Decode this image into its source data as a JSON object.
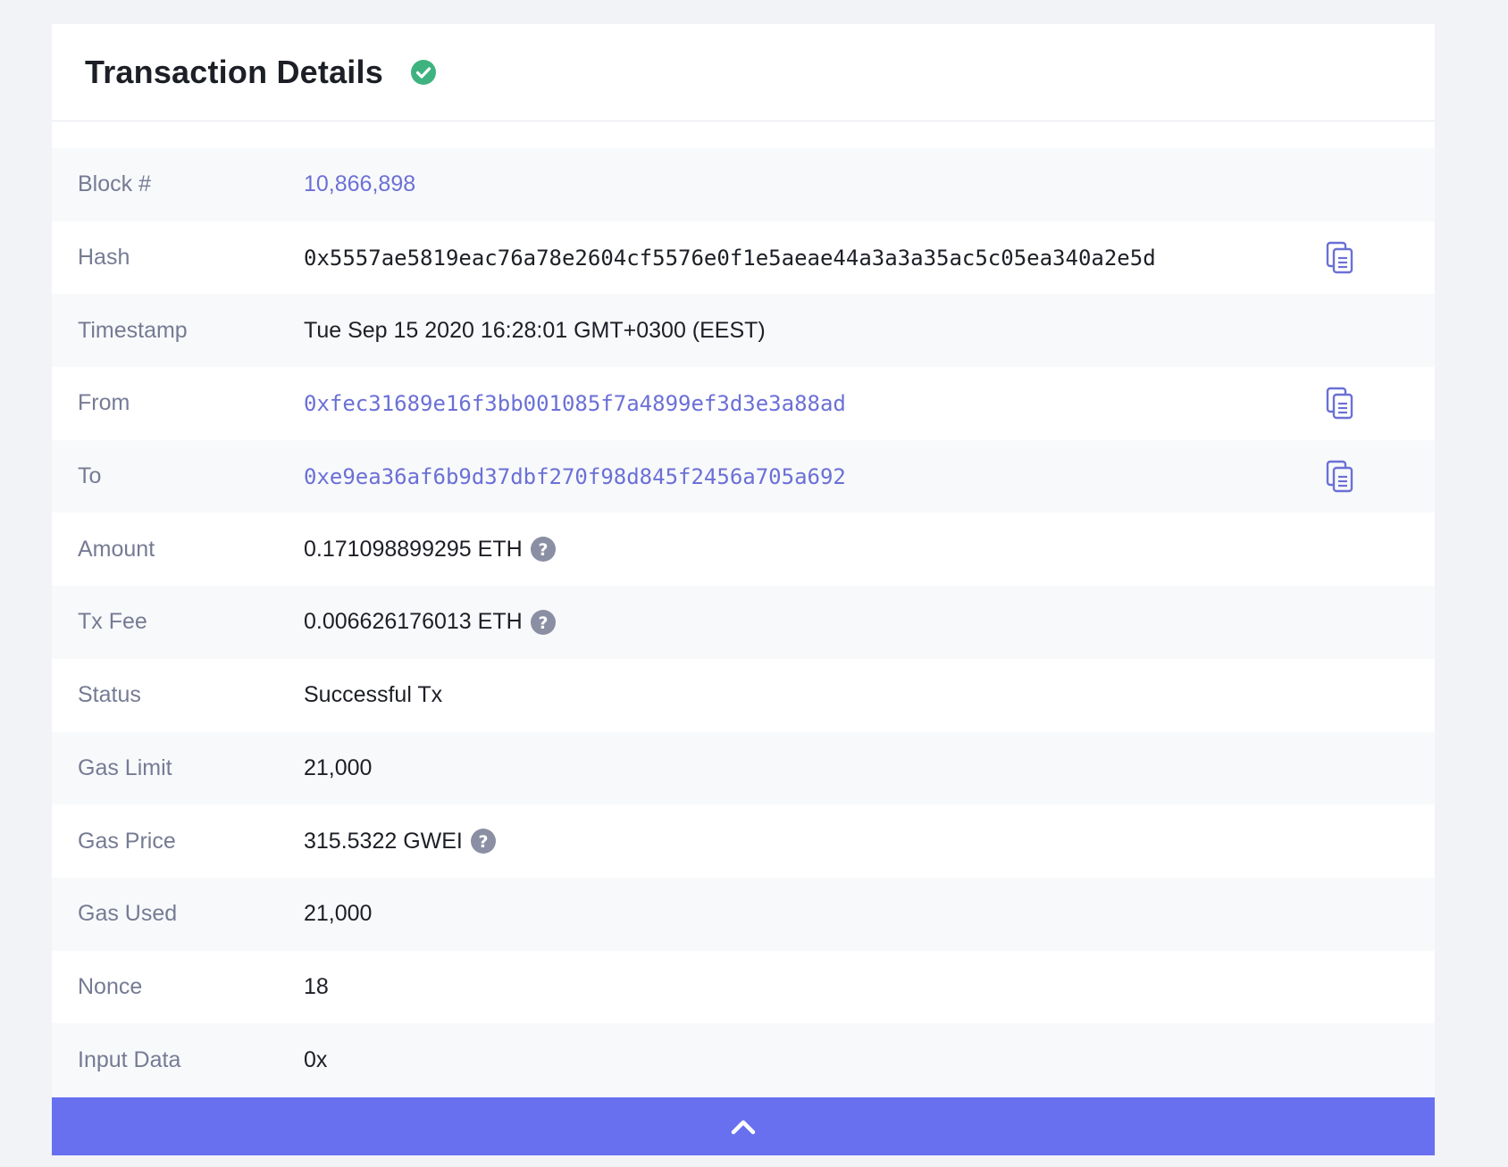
{
  "header": {
    "title": "Transaction Details",
    "status_icon": "check-circle-icon",
    "status_color": "#3fb37f"
  },
  "rows": [
    {
      "label": "Block #",
      "value": "10,866,898"
    },
    {
      "label": "Hash",
      "value": "0x5557ae5819eac76a78e2604cf5576e0f1e5aeae44a3a3a35ac5c05ea340a2e5d"
    },
    {
      "label": "Timestamp",
      "value": "Tue Sep 15 2020 16:28:01 GMT+0300 (EEST)"
    },
    {
      "label": "From",
      "value": "0xfec31689e16f3bb001085f7a4899ef3d3e3a88ad"
    },
    {
      "label": "To",
      "value": "0xe9ea36af6b9d37dbf270f98d845f2456a705a692"
    },
    {
      "label": "Amount",
      "value": "0.171098899295 ETH"
    },
    {
      "label": "Tx Fee",
      "value": "0.006626176013 ETH"
    },
    {
      "label": "Status",
      "value": "Successful Tx"
    },
    {
      "label": "Gas Limit",
      "value": "21,000"
    },
    {
      "label": "Gas Price",
      "value": "315.5322 GWEI"
    },
    {
      "label": "Gas Used",
      "value": "21,000"
    },
    {
      "label": "Nonce",
      "value": "18"
    },
    {
      "label": "Input Data",
      "value": "0x"
    }
  ],
  "icons": {
    "copy": "copy-icon",
    "help": "question-circle-icon",
    "collapse": "chevron-up-icon"
  },
  "colors": {
    "link": "#6b70d6",
    "accent_bar": "#6870f0",
    "label": "#767b94",
    "help_icon": "#8a8fa3"
  }
}
